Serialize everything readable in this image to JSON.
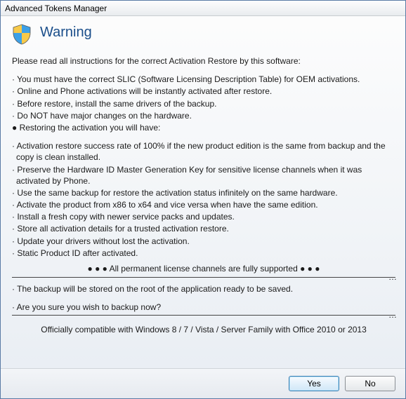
{
  "window": {
    "title": "Advanced Tokens Manager"
  },
  "dialog": {
    "heading": "Warning",
    "intro": "Please read all instructions for the correct Activation Restore by this software:",
    "requirements": [
      "You must have the correct SLIC (Software Licensing Description Table) for OEM activations.",
      "Online and Phone activations will be instantly activated after restore.",
      "Before restore, install the same drivers of the backup.",
      "Do NOT have major changes on the hardware."
    ],
    "restoring_header": "● Restoring the activation you will have:",
    "benefits": [
      "Activation restore success rate of 100% if the new product edition is the same from backup and the copy is clean installed.",
      "Preserve the Hardware ID Master Generation Key for sensitive license channels when it was activated by Phone.",
      "Use the same backup for restore the activation status infinitely on the same hardware.",
      "Activate the product from x86 to x64 and vice versa when have the same edition.",
      "Install a fresh copy with newer service packs and updates.",
      "Store all activation details for a trusted activation restore.",
      "Update your drivers without lost the activation.",
      "Static Product ID after activated."
    ],
    "supported_note": "● ● ● All permanent license channels are fully supported ● ● ●",
    "backup_note": "The backup will be stored on the root of the application ready to be saved.",
    "confirm_question": "Are you sure you wish to backup now?",
    "compat": "Officially compatible with Windows 8 / 7 / Vista / Server Family with Office 2010 or 2013"
  },
  "buttons": {
    "yes": "Yes",
    "no": "No"
  },
  "icons": {
    "shield": "shield-icon"
  }
}
